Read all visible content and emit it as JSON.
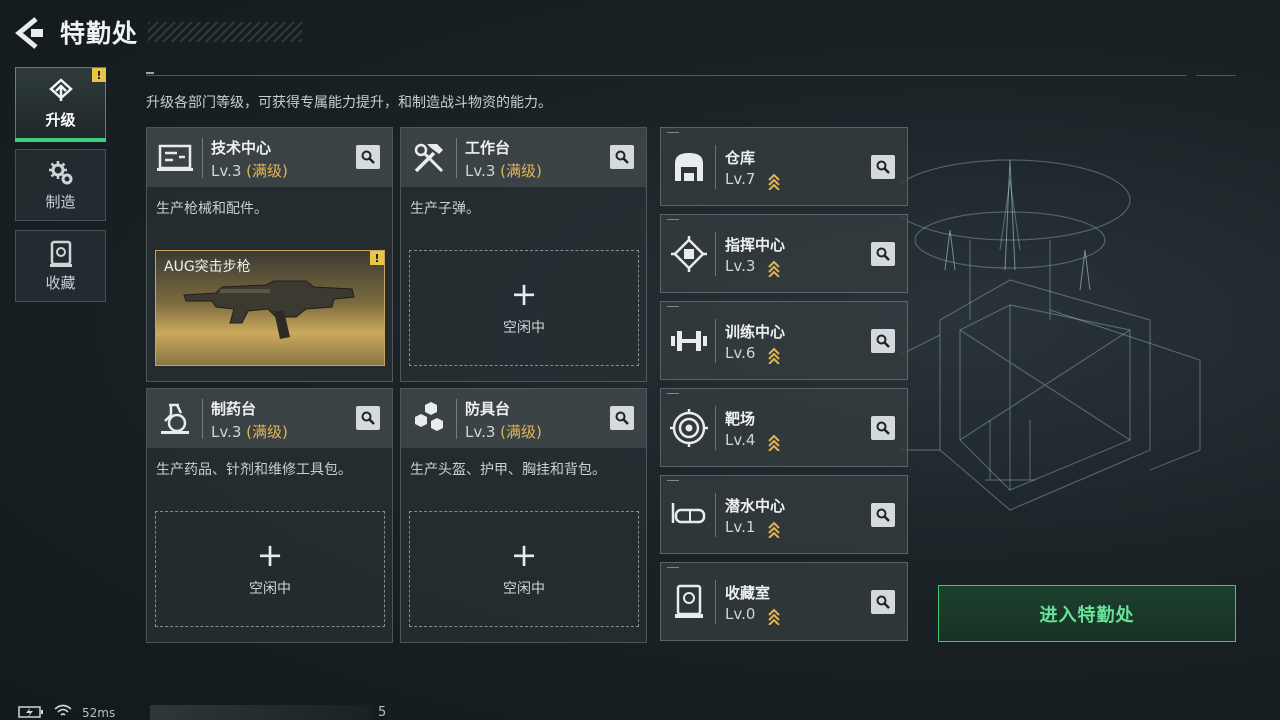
{
  "header": {
    "title": "特勤处"
  },
  "description": "升级各部门等级，可获得专属能力提升，和制造战斗物资的能力。",
  "tabs": [
    {
      "label": "升级",
      "icon": "upgrade-icon",
      "active": true
    },
    {
      "label": "制造",
      "icon": "gears-icon",
      "active": false
    },
    {
      "label": "收藏",
      "icon": "collection-icon",
      "active": false
    }
  ],
  "large_cards": [
    {
      "name": "技术中心",
      "level": "Lv.3",
      "max_label": "(满级)",
      "desc": "生产枪械和配件。",
      "icon": "tech-center-icon",
      "slot": {
        "type": "item",
        "item_name": "AUG突击步枪"
      }
    },
    {
      "name": "工作台",
      "level": "Lv.3",
      "max_label": "(满级)",
      "desc": "生产子弹。",
      "icon": "workbench-icon",
      "slot": {
        "type": "idle",
        "plus": "+",
        "idle_text": "空闲中"
      }
    },
    {
      "name": "制药台",
      "level": "Lv.3",
      "max_label": "(满级)",
      "desc": "生产药品、针剂和维修工具包。",
      "icon": "pharmacy-icon",
      "slot": {
        "type": "idle",
        "plus": "+",
        "idle_text": "空闲中"
      }
    },
    {
      "name": "防具台",
      "level": "Lv.3",
      "max_label": "(满级)",
      "desc": "生产头盔、护甲、胸挂和背包。",
      "icon": "armor-bench-icon",
      "slot": {
        "type": "idle",
        "plus": "+",
        "idle_text": "空闲中"
      }
    }
  ],
  "small_cards": [
    {
      "name": "仓库",
      "level": "Lv.7",
      "icon": "warehouse-icon"
    },
    {
      "name": "指挥中心",
      "level": "Lv.3",
      "icon": "command-center-icon"
    },
    {
      "name": "训练中心",
      "level": "Lv.6",
      "icon": "training-center-icon"
    },
    {
      "name": "靶场",
      "level": "Lv.4",
      "icon": "shooting-range-icon"
    },
    {
      "name": "潜水中心",
      "level": "Lv.1",
      "icon": "diving-center-icon"
    },
    {
      "name": "收藏室",
      "level": "Lv.0",
      "icon": "collection-room-icon"
    }
  ],
  "enter_button": {
    "label": "进入特勤处"
  },
  "status": {
    "ping": "52ms",
    "count": "5"
  },
  "colors": {
    "accent_green": "#3fcf79",
    "gold": "#e2b552",
    "warning": "#e8c447"
  }
}
